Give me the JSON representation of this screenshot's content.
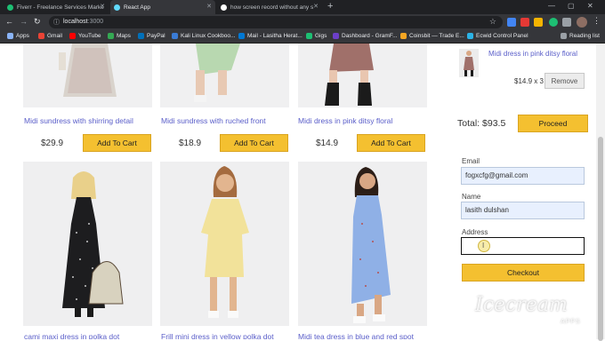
{
  "browser": {
    "tabs": [
      {
        "title": "Fiverr - Freelance Services Marke",
        "favicon_color": "#1dbf73",
        "active": false
      },
      {
        "title": "React App",
        "favicon_color": "#61dafb",
        "active": true
      },
      {
        "title": "how screen record without any s",
        "favicon_color": "#ffffff",
        "active": false
      }
    ],
    "new_tab": "+",
    "window_controls": [
      "—",
      "▢",
      "✕"
    ],
    "url_host": "localhost",
    "url_port": ":3000",
    "bookmarks": [
      {
        "label": "Apps",
        "color": "#8ab4f8"
      },
      {
        "label": "Gmail",
        "color": "#ea4335"
      },
      {
        "label": "YouTube",
        "color": "#ff0000"
      },
      {
        "label": "Maps",
        "color": "#34a853"
      },
      {
        "label": "PayPal",
        "color": "#0070ba"
      },
      {
        "label": "Kali Linux Cookboo...",
        "color": "#3a7bd5"
      },
      {
        "label": "Mail - Lasitha Herat...",
        "color": "#0078d4"
      },
      {
        "label": "Gigs",
        "color": "#1dbf73"
      },
      {
        "label": "Dashboard - GramF...",
        "color": "#6c3fc9"
      },
      {
        "label": "Coinsbit — Trade E...",
        "color": "#f5a623"
      },
      {
        "label": "Ecwid Control Panel",
        "color": "#2bb3e6"
      },
      {
        "label": "Reading list",
        "color": "#9aa0a6"
      }
    ]
  },
  "products_top": [
    {
      "name": "Midi sundress with shirring detail",
      "price": "$29.9",
      "button": "Add To Cart"
    },
    {
      "name": "Midi sundress with ruched front",
      "price": "$18.9",
      "button": "Add To Cart"
    },
    {
      "name": "Midi dress in pink ditsy floral",
      "price": "$14.9",
      "button": "Add To Cart"
    }
  ],
  "products_bottom": [
    {
      "name": "cami maxi dress in polka dot",
      "dress_color": "#1d1d1f"
    },
    {
      "name": "Frill mini dress in yellow polka dot",
      "dress_color": "#f2e29a"
    },
    {
      "name": "Midi tea dress in blue and red spot",
      "dress_color": "#8fb0e6"
    }
  ],
  "cart": {
    "item_name": "Midi dress in pink ditsy floral",
    "item_qty": "$14.9 x 3",
    "remove_label": "Remove",
    "total": "Total: $93.5",
    "proceed_label": "Proceed"
  },
  "form": {
    "email_label": "Email",
    "email_value": "fogxcfg@gmail.com",
    "name_label": "Name",
    "name_value": "lasith dulshan",
    "address_label": "Address",
    "address_value": "",
    "checkout_label": "Checkout"
  },
  "watermark": {
    "line1": "Icecream",
    "line2": "APPS"
  },
  "colors": {
    "accent_button": "#f4c030",
    "link": "#5a5ec9"
  }
}
